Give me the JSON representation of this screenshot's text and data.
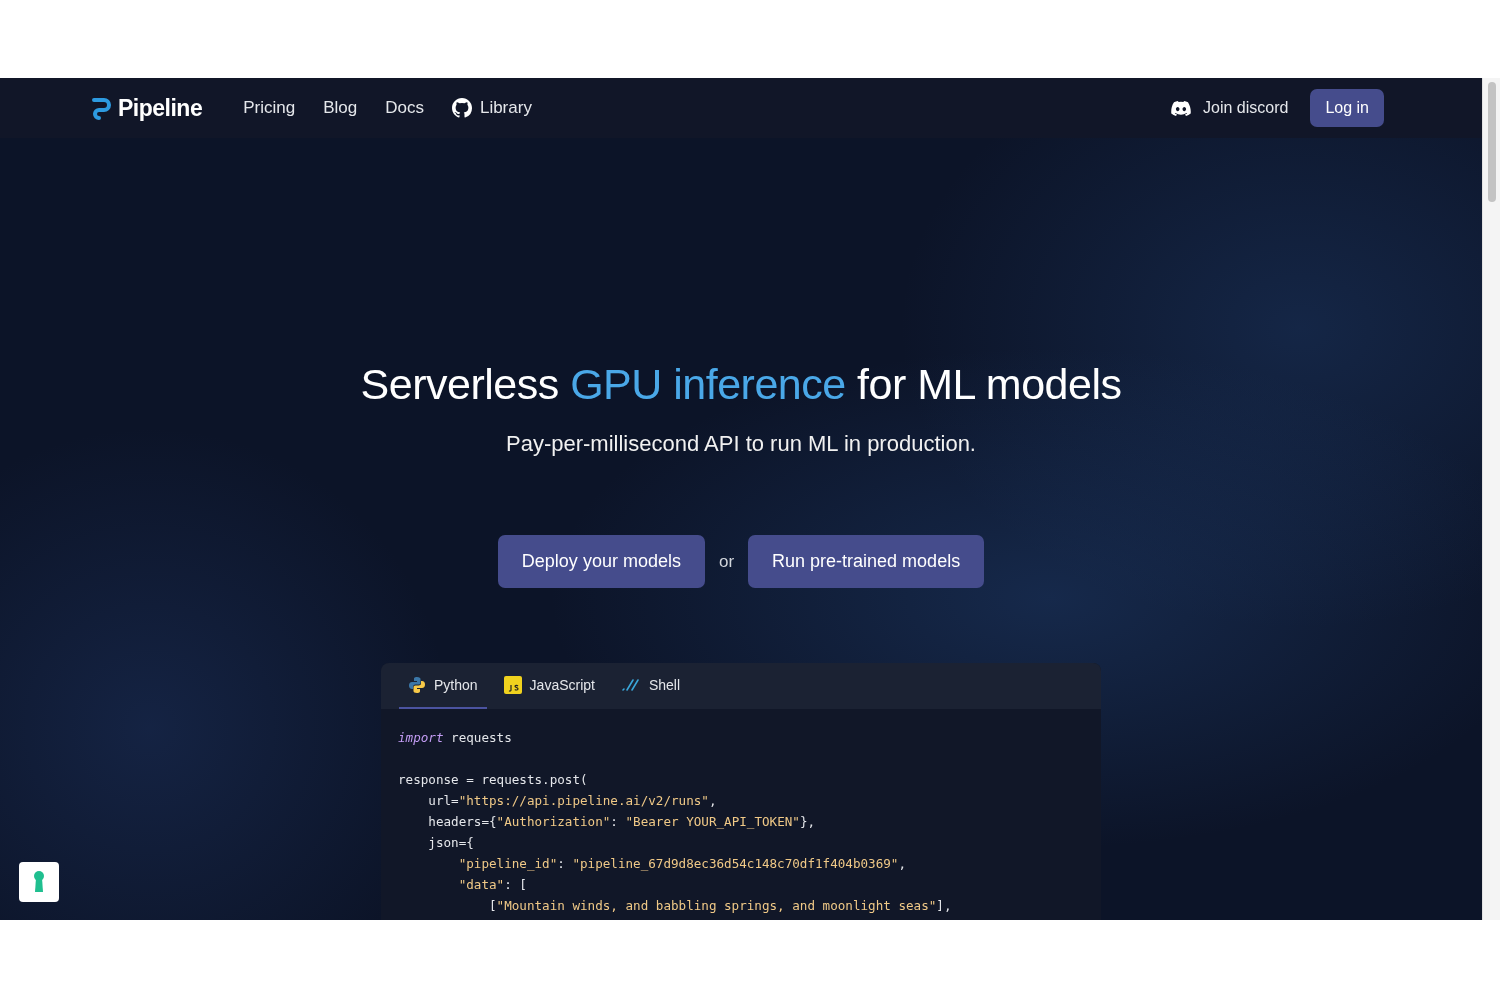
{
  "nav": {
    "brand": "Pipeline",
    "links": [
      "Pricing",
      "Blog",
      "Docs",
      "Library"
    ],
    "discord": "Join discord",
    "login": "Log in"
  },
  "hero": {
    "headline": [
      {
        "text": "Serverless ",
        "highlight": false
      },
      {
        "text": "GPU inference",
        "highlight": true
      },
      {
        "text": " for ML models",
        "highlight": false
      }
    ],
    "subtitle": "Pay-per-millisecond API to run ML in production.",
    "primary_button": "Deploy your models",
    "separator": "or",
    "secondary_button": "Run pre-trained models"
  },
  "code": {
    "tabs": [
      {
        "label": "Python",
        "selected": true
      },
      {
        "label": "JavaScript",
        "selected": false
      },
      {
        "label": "Shell",
        "selected": false
      }
    ],
    "blocks": [
      [
        [
          {
            "text": "import",
            "kind": "keyword"
          },
          {
            "text": " requests",
            "kind": "plain"
          }
        ]
      ],
      [
        [
          {
            "text": "response = requests.post(",
            "kind": "plain"
          }
        ],
        [
          {
            "text": "    url=",
            "kind": "plain"
          },
          {
            "text": "\"https://api.pipeline.ai/v2/runs\"",
            "kind": "string"
          },
          {
            "text": ",",
            "kind": "plain"
          }
        ],
        [
          {
            "text": "    headers={",
            "kind": "plain"
          },
          {
            "text": "\"Authorization\"",
            "kind": "string"
          },
          {
            "text": ": ",
            "kind": "plain"
          },
          {
            "text": "\"Bearer YOUR_API_TOKEN\"",
            "kind": "string"
          },
          {
            "text": "},",
            "kind": "plain"
          }
        ],
        [
          {
            "text": "    json={",
            "kind": "plain"
          }
        ],
        [
          {
            "text": "        \"pipeline_id\"",
            "kind": "string"
          },
          {
            "text": ": ",
            "kind": "plain"
          },
          {
            "text": "\"pipeline_67d9d8ec36d54c148c70df1f404b0369\"",
            "kind": "string"
          },
          {
            "text": ",",
            "kind": "plain"
          }
        ],
        [
          {
            "text": "        \"data\"",
            "kind": "string"
          },
          {
            "text": ": [",
            "kind": "plain"
          }
        ],
        [
          {
            "text": "            [",
            "kind": "plain"
          },
          {
            "text": "\"Mountain winds, and babbling springs, and moonlight seas\"",
            "kind": "string"
          },
          {
            "text": "],",
            "kind": "plain"
          }
        ]
      ]
    ]
  }
}
